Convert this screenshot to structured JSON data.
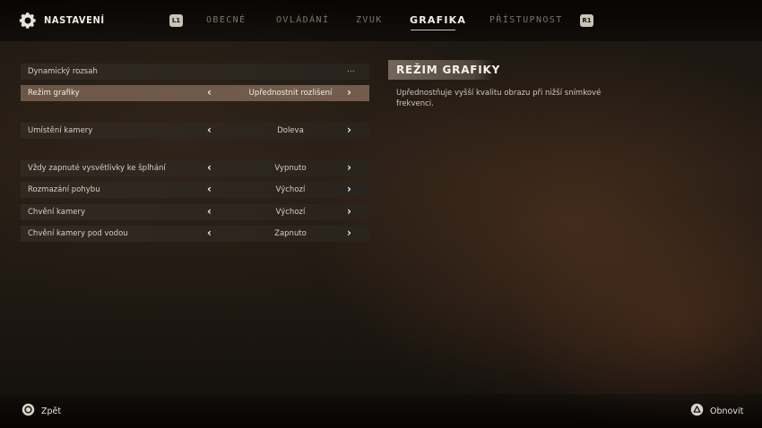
{
  "header": {
    "title": "NASTAVENÍ",
    "left_button": "L1",
    "right_button": "R1",
    "tabs": [
      {
        "label": "OBECNÉ"
      },
      {
        "label": "OVLÁDÁNÍ"
      },
      {
        "label": "ZVUK"
      },
      {
        "label": "GRAFIKA"
      },
      {
        "label": "PŘÍSTUPNOST"
      }
    ],
    "active_tab": "GRAFIKA"
  },
  "settings": [
    {
      "label": "Dynamický rozsah",
      "value": "",
      "more": "..."
    },
    {
      "label": "Režim grafiky",
      "value": "Upřednostnit rozlišení"
    },
    {
      "label": "Umístění kamery",
      "value": "Doleva"
    },
    {
      "label": "Vždy zapnuté vysvětlivky ke šplhání",
      "value": "Vypnuto"
    },
    {
      "label": "Rozmazání pohybu",
      "value": "Výchozí"
    },
    {
      "label": "Chvění kamery",
      "value": "Výchozí"
    },
    {
      "label": "Chvění kamery pod vodou",
      "value": "Zapnuto"
    }
  ],
  "selected_setting": "Režim grafiky",
  "arrows": {
    "left": "‹",
    "right": "›"
  },
  "info_panel": {
    "title": "REŽIM GRAFIKY",
    "description": "Upřednostňuje vyšší kvalitu obrazu při nižší snímkové frekvenci."
  },
  "footer": {
    "back_label": "Zpět",
    "back_icon": "circle-button-icon",
    "reset_label": "Obnovit",
    "reset_icon": "triangle-button-icon"
  }
}
